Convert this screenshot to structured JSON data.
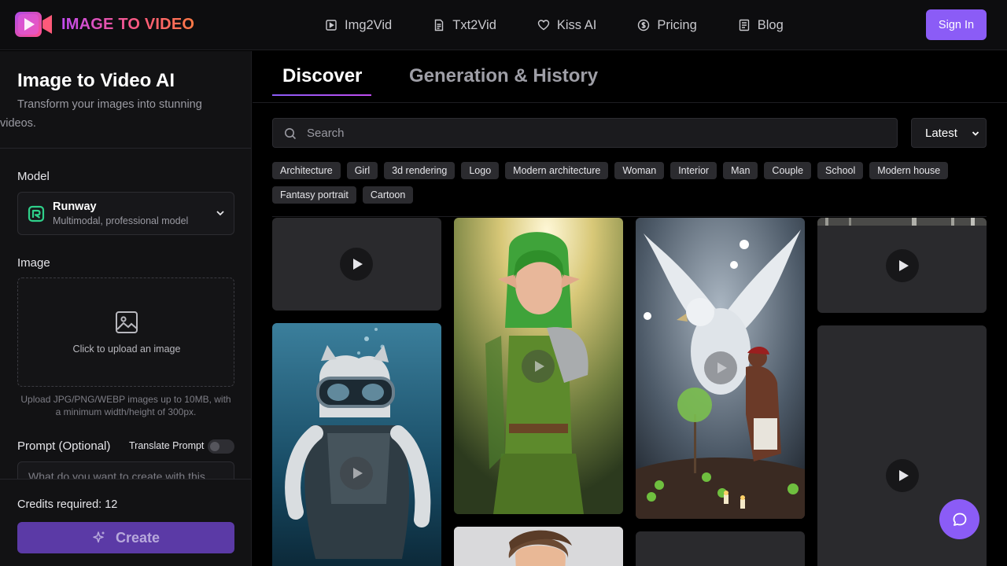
{
  "header": {
    "brand": "IMAGE TO VIDEO",
    "nav": [
      {
        "label": "Img2Vid",
        "icon": "play-square-icon"
      },
      {
        "label": "Txt2Vid",
        "icon": "document-icon"
      },
      {
        "label": "Kiss AI",
        "icon": "heart-icon"
      },
      {
        "label": "Pricing",
        "icon": "dollar-circle-icon"
      },
      {
        "label": "Blog",
        "icon": "blog-icon"
      }
    ],
    "sign_in": "Sign In"
  },
  "sidebar": {
    "title": "Image to Video AI",
    "subtitle": "Transform your images into stunning videos.",
    "model_label": "Model",
    "model": {
      "name": "Runway",
      "description": "Multimodal, professional model"
    },
    "image_label": "Image",
    "upload_text": "Click to upload an image",
    "upload_hint": "Upload JPG/PNG/WEBP images up to 10MB, with a minimum width/height of 300px.",
    "prompt_label": "Prompt (Optional)",
    "translate_label": "Translate Prompt",
    "prompt_placeholder": "What do you want to create with this",
    "credits": "Credits required: 12",
    "create_label": "Create"
  },
  "main": {
    "tabs": [
      {
        "label": "Discover",
        "active": true
      },
      {
        "label": "Generation & History",
        "active": false
      }
    ],
    "search_placeholder": "Search",
    "sort": "Latest",
    "tags": [
      "Architecture",
      "Girl",
      "3d rendering",
      "Logo",
      "Modern architecture",
      "Woman",
      "Interior",
      "Man",
      "Couple",
      "School",
      "Modern house",
      "Fantasy portrait",
      "Cartoon"
    ]
  },
  "colors": {
    "accent": "#8b5cf6",
    "create_button": "#5b3aa6",
    "background": "#000000",
    "sidebar": "#121214",
    "chip": "#2b2b2f"
  }
}
